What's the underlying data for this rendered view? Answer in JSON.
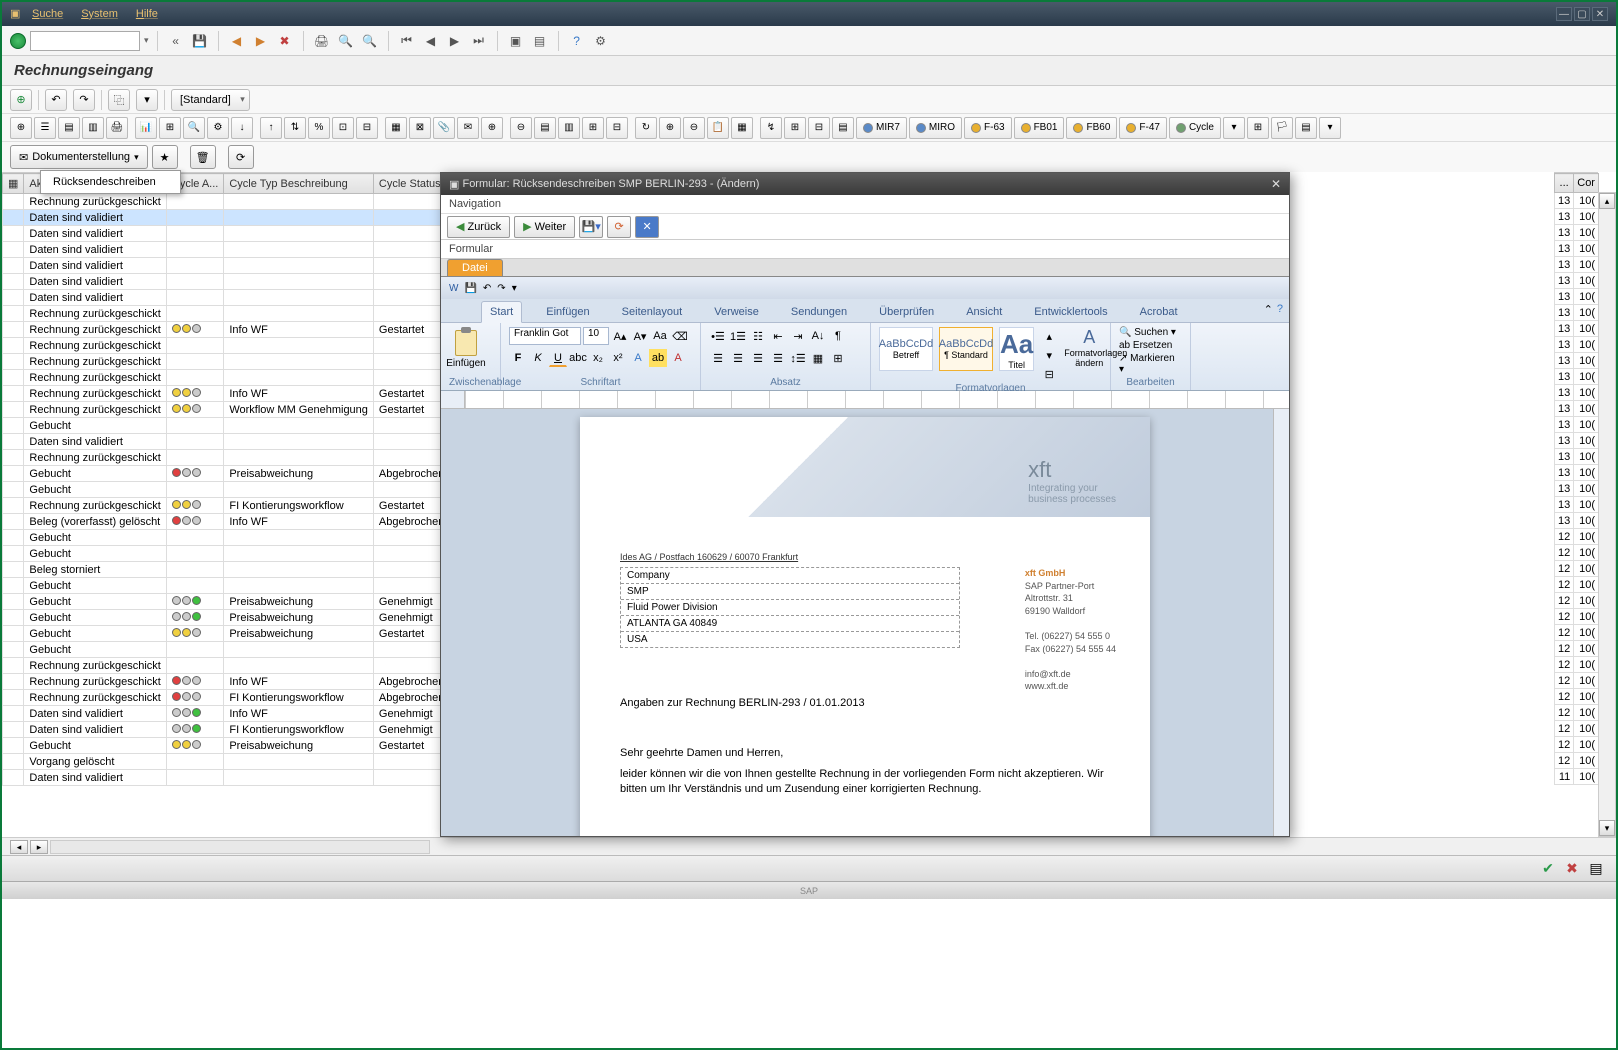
{
  "menubar": {
    "items": [
      "Suche",
      "System",
      "Hilfe"
    ]
  },
  "page_title": "Rechnungseingang",
  "secondary_toolbar": {
    "layout_label": "[Standard]"
  },
  "button_row": {
    "labeled": [
      {
        "label": "MIR7",
        "color": "#5a8ac8"
      },
      {
        "label": "MIRO",
        "color": "#5a8ac8"
      },
      {
        "label": "F-63",
        "color": "#e8b030"
      },
      {
        "label": "FB01",
        "color": "#e8b030"
      },
      {
        "label": "FB60",
        "color": "#e8b030"
      },
      {
        "label": "F-47",
        "color": "#e8b030"
      },
      {
        "label": "Cycle",
        "color": "#70a070"
      }
    ]
  },
  "action_row": {
    "main_button": "Dokumenterstellung",
    "dropdown_item": "Rücksendeschreiben"
  },
  "table": {
    "columns": [
      "Aktueller Zustand",
      "Cycle A...",
      "Cycle Typ Beschreibung",
      "Cycle Status"
    ],
    "rows": [
      {
        "state": "Rechnung zurückgeschickt",
        "icons": "",
        "typ": "",
        "status": ""
      },
      {
        "state": "Daten sind validiert",
        "icons": "",
        "typ": "",
        "status": "",
        "selected": true
      },
      {
        "state": "Daten sind validiert",
        "icons": "",
        "typ": "",
        "status": ""
      },
      {
        "state": "Daten sind validiert",
        "icons": "",
        "typ": "",
        "status": ""
      },
      {
        "state": "Daten sind validiert",
        "icons": "",
        "typ": "",
        "status": ""
      },
      {
        "state": "Daten sind validiert",
        "icons": "",
        "typ": "",
        "status": ""
      },
      {
        "state": "Daten sind validiert",
        "icons": "",
        "typ": "",
        "status": ""
      },
      {
        "state": "Rechnung zurückgeschickt",
        "icons": "",
        "typ": "",
        "status": ""
      },
      {
        "state": "Rechnung zurückgeschickt",
        "icons": "yyg",
        "typ": "Info WF",
        "status": "Gestartet"
      },
      {
        "state": "Rechnung zurückgeschickt",
        "icons": "",
        "typ": "",
        "status": ""
      },
      {
        "state": "Rechnung zurückgeschickt",
        "icons": "",
        "typ": "",
        "status": ""
      },
      {
        "state": "Rechnung zurückgeschickt",
        "icons": "",
        "typ": "",
        "status": ""
      },
      {
        "state": "Rechnung zurückgeschickt",
        "icons": "yyg",
        "typ": "Info WF",
        "status": "Gestartet"
      },
      {
        "state": "Rechnung zurückgeschickt",
        "icons": "yyg",
        "typ": "Workflow MM Genehmigung",
        "status": "Gestartet"
      },
      {
        "state": "Gebucht",
        "icons": "",
        "typ": "",
        "status": ""
      },
      {
        "state": "Daten sind validiert",
        "icons": "",
        "typ": "",
        "status": ""
      },
      {
        "state": "Rechnung zurückgeschickt",
        "icons": "",
        "typ": "",
        "status": ""
      },
      {
        "state": "Gebucht",
        "icons": "rgg",
        "typ": "Preisabweichung",
        "status": "Abgebrochen"
      },
      {
        "state": "Gebucht",
        "icons": "",
        "typ": "",
        "status": ""
      },
      {
        "state": "Rechnung zurückgeschickt",
        "icons": "yyg",
        "typ": "FI Kontierungsworkflow",
        "status": "Gestartet"
      },
      {
        "state": "Beleg (vorerfasst) gelöscht",
        "icons": "rgg",
        "typ": "Info WF",
        "status": "Abgebrochen"
      },
      {
        "state": "Gebucht",
        "icons": "",
        "typ": "",
        "status": ""
      },
      {
        "state": "Gebucht",
        "icons": "",
        "typ": "",
        "status": ""
      },
      {
        "state": "Beleg storniert",
        "icons": "",
        "typ": "",
        "status": ""
      },
      {
        "state": "Gebucht",
        "icons": "",
        "typ": "",
        "status": ""
      },
      {
        "state": "Gebucht",
        "icons": "ggn",
        "typ": "Preisabweichung",
        "status": "Genehmigt"
      },
      {
        "state": "Gebucht",
        "icons": "ggn",
        "typ": "Preisabweichung",
        "status": "Genehmigt"
      },
      {
        "state": "Gebucht",
        "icons": "yyg",
        "typ": "Preisabweichung",
        "status": "Gestartet"
      },
      {
        "state": "Gebucht",
        "icons": "",
        "typ": "",
        "status": ""
      },
      {
        "state": "Rechnung zurückgeschickt",
        "icons": "",
        "typ": "",
        "status": ""
      },
      {
        "state": "Rechnung zurückgeschickt",
        "icons": "rgg",
        "typ": "Info WF",
        "status": "Abgebrochen"
      },
      {
        "state": "Rechnung zurückgeschickt",
        "icons": "rgg",
        "typ": "FI Kontierungsworkflow",
        "status": "Abgebrochen"
      },
      {
        "state": "Daten sind validiert",
        "icons": "ggn",
        "typ": "Info WF",
        "status": "Genehmigt"
      },
      {
        "state": "Daten sind validiert",
        "icons": "ggn",
        "typ": "FI Kontierungsworkflow",
        "status": "Genehmigt"
      },
      {
        "state": "Gebucht",
        "icons": "yyg",
        "typ": "Preisabweichung",
        "status": "Gestartet"
      },
      {
        "state": "Vorgang gelöscht",
        "icons": "",
        "typ": "",
        "status": ""
      },
      {
        "state": "Daten sind validiert",
        "icons": "",
        "typ": "",
        "status": ""
      }
    ]
  },
  "right_cols": {
    "headers": [
      "...",
      "Cor"
    ],
    "rows": [
      [
        "13",
        "10("
      ],
      [
        "13",
        "10("
      ],
      [
        "13",
        "10("
      ],
      [
        "13",
        "10("
      ],
      [
        "13",
        "10("
      ],
      [
        "13",
        "10("
      ],
      [
        "13",
        "10("
      ],
      [
        "13",
        "10("
      ],
      [
        "13",
        "10("
      ],
      [
        "13",
        "10("
      ],
      [
        "13",
        "10("
      ],
      [
        "13",
        "10("
      ],
      [
        "13",
        "10("
      ],
      [
        "13",
        "10("
      ],
      [
        "13",
        "10("
      ],
      [
        "13",
        "10("
      ],
      [
        "13",
        "10("
      ],
      [
        "13",
        "10("
      ],
      [
        "13",
        "10("
      ],
      [
        "13",
        "10("
      ],
      [
        "13",
        "10("
      ],
      [
        "12",
        "10("
      ],
      [
        "12",
        "10("
      ],
      [
        "12",
        "10("
      ],
      [
        "12",
        "10("
      ],
      [
        "12",
        "10("
      ],
      [
        "12",
        "10("
      ],
      [
        "12",
        "10("
      ],
      [
        "12",
        "10("
      ],
      [
        "12",
        "10("
      ],
      [
        "12",
        "10("
      ],
      [
        "12",
        "10("
      ],
      [
        "12",
        "10("
      ],
      [
        "12",
        "10("
      ],
      [
        "12",
        "10("
      ],
      [
        "12",
        "10("
      ],
      [
        "11",
        "10("
      ]
    ]
  },
  "modal": {
    "title": "Formular: Rücksendeschreiben SMP BERLIN-293 - (Ändern)",
    "nav_label": "Navigation",
    "back": "Zurück",
    "forward": "Weiter",
    "form_label": "Formular",
    "tab": "Datei"
  },
  "word": {
    "tabs": [
      "Start",
      "Einfügen",
      "Seitenlayout",
      "Verweise",
      "Sendungen",
      "Überprüfen",
      "Ansicht",
      "Entwicklertools",
      "Acrobat"
    ],
    "paste": "Einfügen",
    "clipboard": "Zwischenablage",
    "font_name": "Franklin Got",
    "font_size": "10",
    "font_group": "Schriftart",
    "para_group": "Absatz",
    "styles_group": "Formatvorlagen",
    "edit_group": "Bearbeiten",
    "style_sample": "AaBbCcDd",
    "style_heading": "Betreff",
    "style_standard": "¶ Standard",
    "style_title": "Titel",
    "styles_change": "Formatvorlagen ändern",
    "find": "Suchen",
    "replace": "Ersetzen",
    "select": "Markieren"
  },
  "doc": {
    "logo": "xft",
    "tagline1": "Integrating your",
    "tagline2": "business processes",
    "sender": "Ides AG / Postfach 160629 / 60070 Frankfurt",
    "addr": [
      "Company",
      "SMP",
      "Fluid Power Division",
      "ATLANTA GA  40849",
      "USA"
    ],
    "company_name": "xft GmbH",
    "company_lines": [
      "SAP Partner-Port",
      "Altrottstr. 31",
      "69190 Walldorf",
      "",
      "Tel. (06227) 54 555 0",
      "Fax (06227) 54 555 44",
      "",
      "info@xft.de",
      "www.xft.de"
    ],
    "subject": "Angaben zur Rechnung BERLIN-293 / 01.01.2013",
    "greeting": "Sehr geehrte Damen und Herren,",
    "body": "leider können wir die von Ihnen gestellte Rechnung in der vorliegenden Form nicht akzeptieren. Wir bitten um Ihr Verständnis und um Zusendung einer korrigierten Rechnung."
  },
  "footer": "SAP"
}
